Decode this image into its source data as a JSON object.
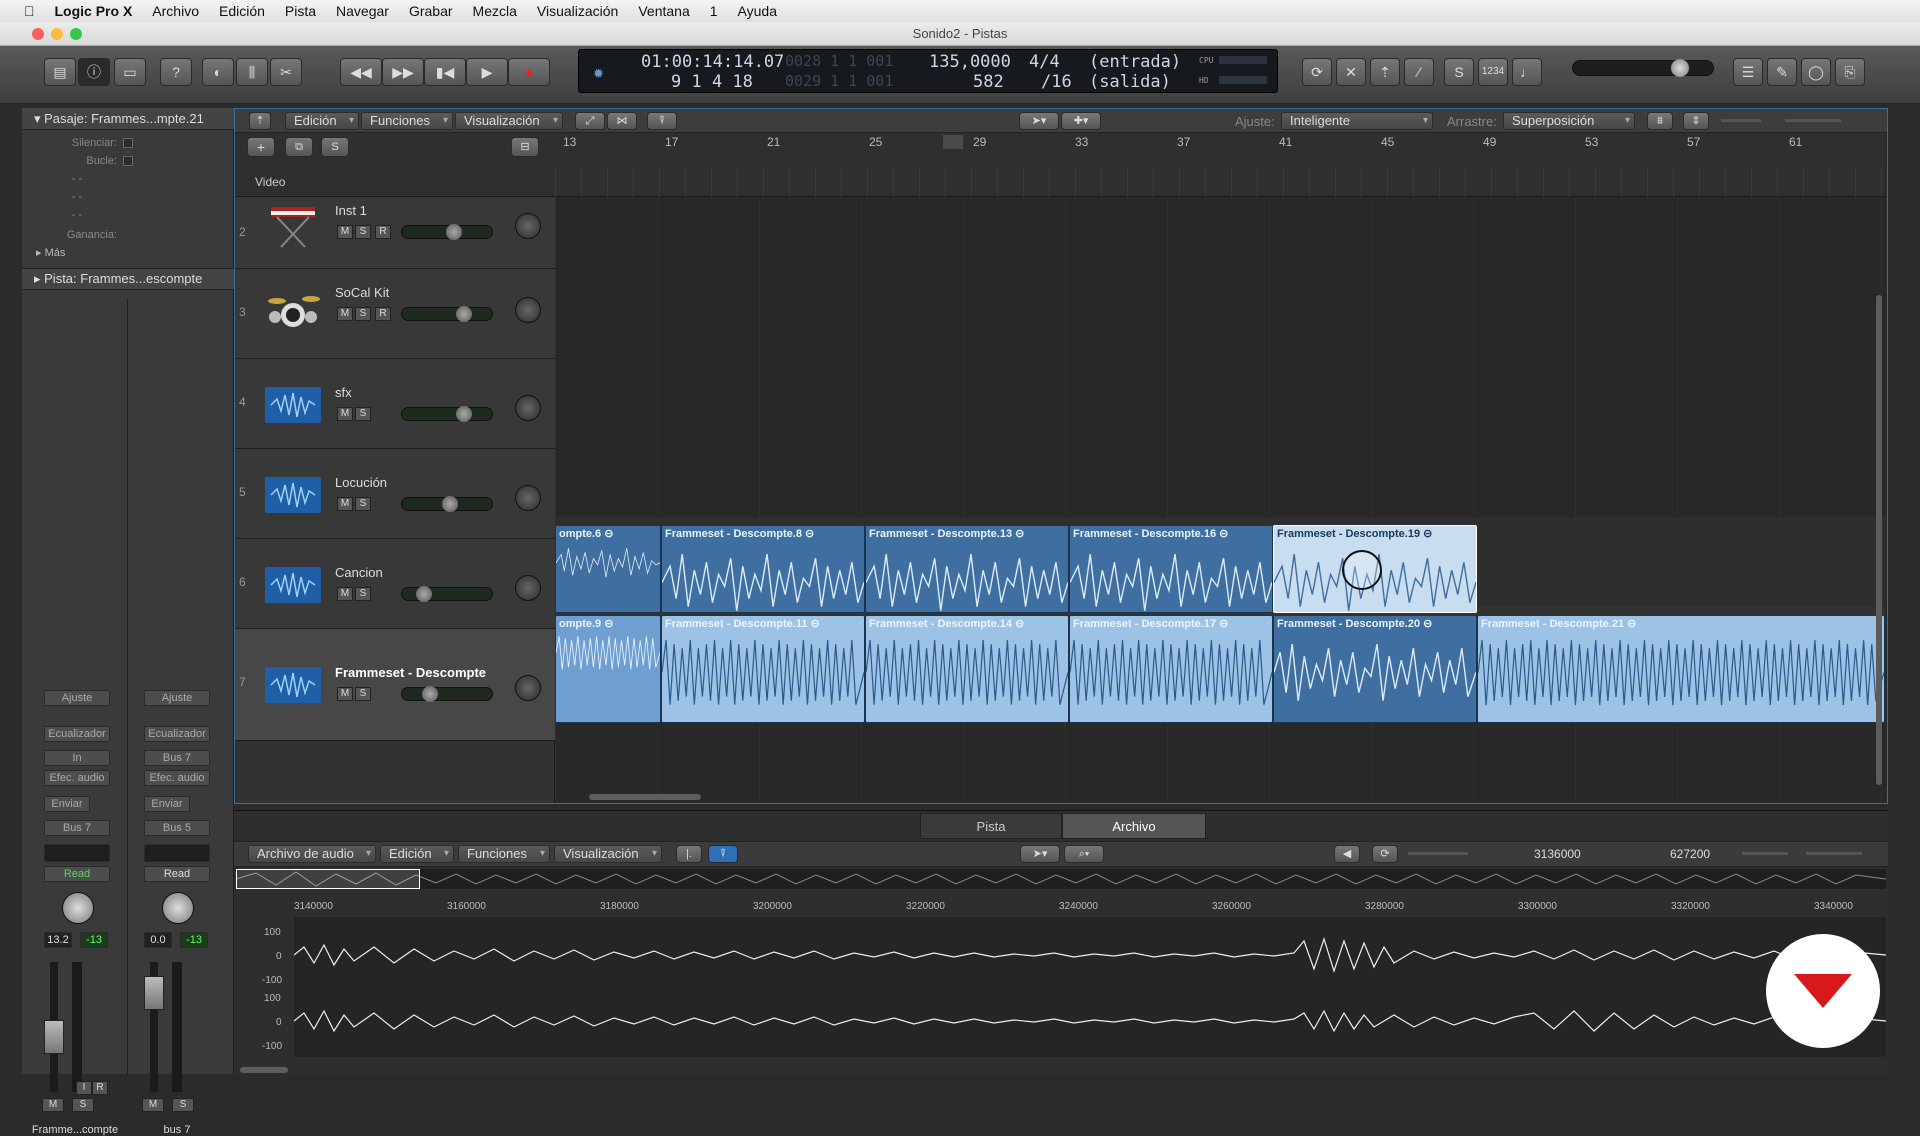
{
  "menubar": {
    "app": "Logic Pro X",
    "items": [
      "Archivo",
      "Edición",
      "Pista",
      "Navegar",
      "Grabar",
      "Mezcla",
      "Visualización",
      "Ventana",
      "1",
      "Ayuda"
    ]
  },
  "window": {
    "title": "Sonido2 - Pistas"
  },
  "lcd": {
    "time": "01:00:14:14.07",
    "bars": "9  1  4  18",
    "pos1": "0028  1  1  001",
    "pos2": "0029  1  1  001",
    "tempo": "135,0000",
    "key": "582",
    "sig": "4/4",
    "div": "/16",
    "in": "(entrada)",
    "out": "(salida)",
    "cpu": "CPU",
    "hd": "HD"
  },
  "inspector": {
    "region_header": "Pasaje: Frammes...mpte.21",
    "silenciar": "Silenciar:",
    "bucle": "Bucle:",
    "dash1": "- -",
    "dash2": "- -",
    "dash3": "- -",
    "ganancia": "Ganancia:",
    "mas": "Más",
    "track_header": "Pista: Frammes...escompte",
    "strip1": {
      "ajuste": "Ajuste",
      "eq": "Ecualizador",
      "input": "In",
      "efec": "Efec. audio",
      "enviar": "Enviar",
      "bus": "Bus 7",
      "mode": "Read",
      "vol": "13.2",
      "peak": "-13",
      "name": "Framme...compte",
      "m": "M",
      "s": "S",
      "i": "I",
      "r": "R"
    },
    "strip2": {
      "ajuste": "Ajuste",
      "eq": "Ecualizador",
      "input": "Bus 7",
      "efec": "Efec. audio",
      "enviar": "Enviar",
      "bus": "Bus 5",
      "mode": "Read",
      "vol": "0.0",
      "peak": "-13",
      "name": "bus 7",
      "m": "M",
      "s": "S"
    }
  },
  "tracks_toolbar": {
    "edicion": "Edición",
    "funciones": "Funciones",
    "visualizacion": "Visualización",
    "ajuste_lbl": "Ajuste:",
    "ajuste_val": "Inteligente",
    "arrastre_lbl": "Arrastre:",
    "arrastre_val": "Superposición",
    "plus": "+",
    "s": "S"
  },
  "video_label": "Video",
  "ruler_bars": [
    "13",
    "17",
    "21",
    "25",
    "29",
    "33",
    "37",
    "41",
    "45",
    "49",
    "53",
    "57",
    "61"
  ],
  "tracks": [
    {
      "num": "2",
      "name": "Inst 1",
      "m": "M",
      "s": "S",
      "r": "R"
    },
    {
      "num": "3",
      "name": "SoCal Kit",
      "m": "M",
      "s": "S",
      "r": "R"
    },
    {
      "num": "4",
      "name": "sfx",
      "m": "M",
      "s": "S"
    },
    {
      "num": "5",
      "name": "Locución",
      "m": "M",
      "s": "S"
    },
    {
      "num": "6",
      "name": "Cancion",
      "m": "M",
      "s": "S"
    },
    {
      "num": "7",
      "name": "Frammeset - Descompte",
      "m": "M",
      "s": "S"
    }
  ],
  "regions_row6": [
    "ompte.6",
    "Frammeset - Descompte.8",
    "Frammeset - Descompte.13",
    "Frammeset - Descompte.16",
    "Frammeset - Descompte.19"
  ],
  "regions_row7": [
    "ompte.9",
    "Frammeset - Descompte.11",
    "Frammeset - Descompte.14",
    "Frammeset - Descompte.17",
    "Frammeset - Descompte.20",
    "Frammeset - Descompte.21"
  ],
  "editor": {
    "tab_pista": "Pista",
    "tab_archivo": "Archivo",
    "archivo_audio": "Archivo de audio",
    "edicion": "Edición",
    "funciones": "Funciones",
    "visualizacion": "Visualización",
    "val1": "3136000",
    "val2": "627200",
    "axis": [
      "3140000",
      "3160000",
      "3180000",
      "3200000",
      "3220000",
      "3240000",
      "3260000",
      "3280000",
      "3300000",
      "3320000",
      "3340000"
    ],
    "amp": [
      "100",
      "0",
      "-100",
      "100",
      "0",
      "-100"
    ]
  },
  "colors": {
    "region": "#3f6fa0",
    "region_light": "#9cc3e6",
    "selected": "#c9ddf0",
    "brand": "#d7191c"
  }
}
